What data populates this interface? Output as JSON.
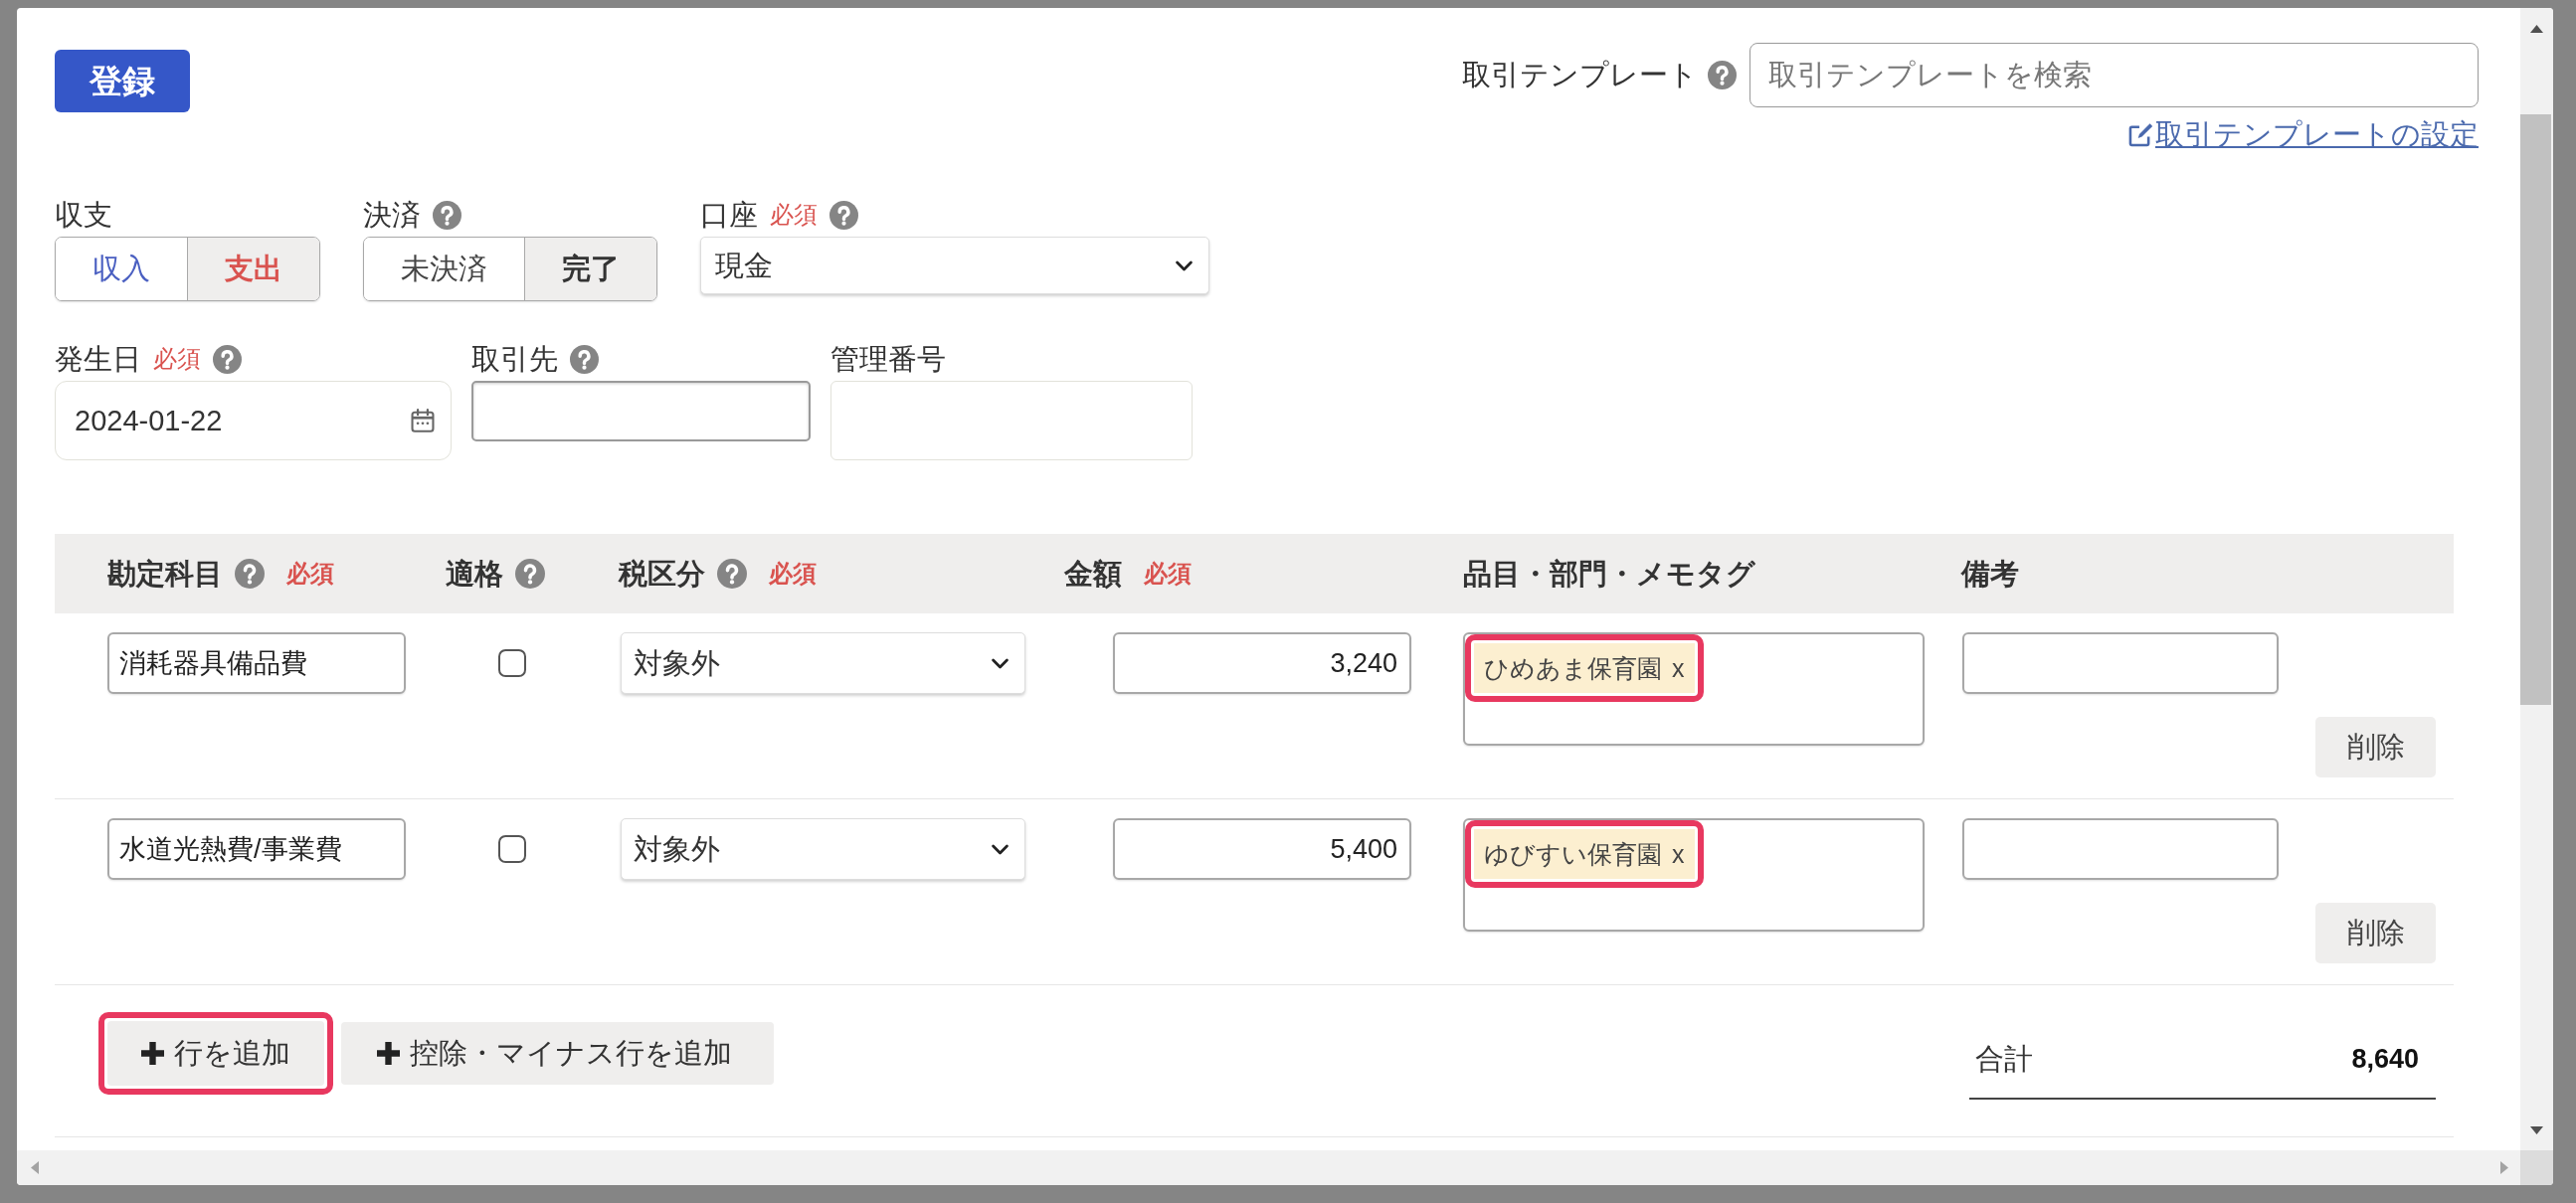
{
  "header": {
    "submit_button": "登録",
    "template": {
      "label": "取引テンプレート",
      "help": true,
      "placeholder": "取引テンプレートを検索",
      "settings_link": "取引テンプレートの設定"
    }
  },
  "form": {
    "income_expense": {
      "label": "収支",
      "options": [
        {
          "label": "収入",
          "selected": false,
          "color": "#4a5fc1"
        },
        {
          "label": "支出",
          "selected": true,
          "color": "#d9534f"
        }
      ]
    },
    "settlement": {
      "label": "決済",
      "help": true,
      "options": [
        {
          "label": "未決済",
          "selected": false
        },
        {
          "label": "完了",
          "selected": true
        }
      ]
    },
    "account": {
      "label": "口座",
      "required": "必須",
      "help": true,
      "value": "現金"
    },
    "date": {
      "label": "発生日",
      "required": "必須",
      "help": true,
      "value": "2024-01-22"
    },
    "partner": {
      "label": "取引先",
      "help": true
    },
    "management_number": {
      "label": "管理番号"
    }
  },
  "table": {
    "columns": [
      {
        "label": "勘定科目",
        "help": true,
        "required": "必須"
      },
      {
        "label": "適格",
        "help": true
      },
      {
        "label": "税区分",
        "help": true,
        "required": "必須"
      },
      {
        "label": "金額",
        "required": "必須"
      },
      {
        "label": "品目・部門・メモタグ"
      },
      {
        "label": "備考"
      }
    ],
    "rows": [
      {
        "account": "消耗器具備品費",
        "qualified": false,
        "tax": "対象外",
        "amount": "3,240",
        "tags": [
          {
            "label": "ひめあま保育園",
            "remove": "x",
            "highlighted": true
          }
        ],
        "delete_button": "削除"
      },
      {
        "account": "水道光熱費/事業費",
        "qualified": false,
        "tax": "対象外",
        "amount": "5,400",
        "tags": [
          {
            "label": "ゆびすい保育園",
            "remove": "x",
            "highlighted": true
          }
        ],
        "delete_button": "削除"
      }
    ]
  },
  "footer": {
    "add_buttons": [
      {
        "label": "行を追加",
        "highlighted": true
      },
      {
        "label": "控除・マイナス行を追加",
        "highlighted": false
      }
    ],
    "total_label": "合計",
    "total": "8,640"
  }
}
